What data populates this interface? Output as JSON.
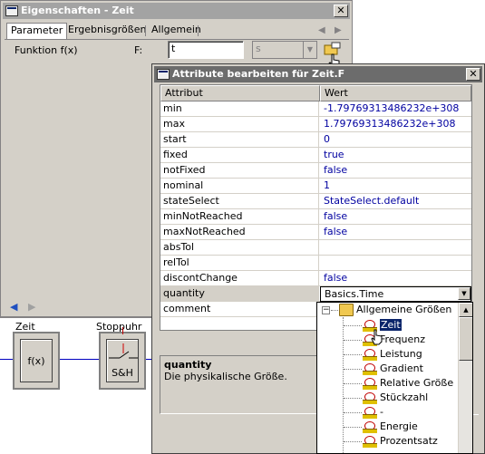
{
  "back_window": {
    "title": "Eigenschaften - Zeit",
    "close": "✕",
    "tabs": [
      "Parameter",
      "Ergebnisgrößen",
      "Allgemein"
    ],
    "function_label": "Funktion f(x)",
    "f_label": "F:",
    "f_value": "t",
    "unit_combo_value": "s",
    "nav_back": "◀",
    "nav_forward": "▶"
  },
  "diagram": {
    "block1_label": "Zeit",
    "block1_text": "f(x)",
    "block2_label": "Stoppuhr",
    "block2_text": "S&H"
  },
  "dialog": {
    "title": "Attribute bearbeiten für Zeit.F",
    "close": "✕",
    "columns": [
      "Attribut",
      "Wert"
    ],
    "rows": [
      {
        "attr": "min",
        "value": "-1.79769313486232e+308"
      },
      {
        "attr": "max",
        "value": "1.79769313486232e+308"
      },
      {
        "attr": "start",
        "value": "0"
      },
      {
        "attr": "fixed",
        "value": "true"
      },
      {
        "attr": "notFixed",
        "value": "false"
      },
      {
        "attr": "nominal",
        "value": "1"
      },
      {
        "attr": "stateSelect",
        "value": "StateSelect.default"
      },
      {
        "attr": "minNotReached",
        "value": "false"
      },
      {
        "attr": "maxNotReached",
        "value": "false"
      },
      {
        "attr": "absTol",
        "value": ""
      },
      {
        "attr": "relTol",
        "value": ""
      },
      {
        "attr": "discontChange",
        "value": "false"
      },
      {
        "attr": "quantity",
        "value": "Basics.Time"
      },
      {
        "attr": "comment",
        "value": ""
      }
    ],
    "description_title": "quantity",
    "description_text": "Die physikalische Größe."
  },
  "tree": {
    "root": "Allgemeine Größen",
    "items": [
      "Zeit",
      "Frequenz",
      "Leistung",
      "Gradient",
      "Relative Größe",
      "Stückzahl",
      "-",
      "Energie",
      "Prozentsatz"
    ]
  }
}
